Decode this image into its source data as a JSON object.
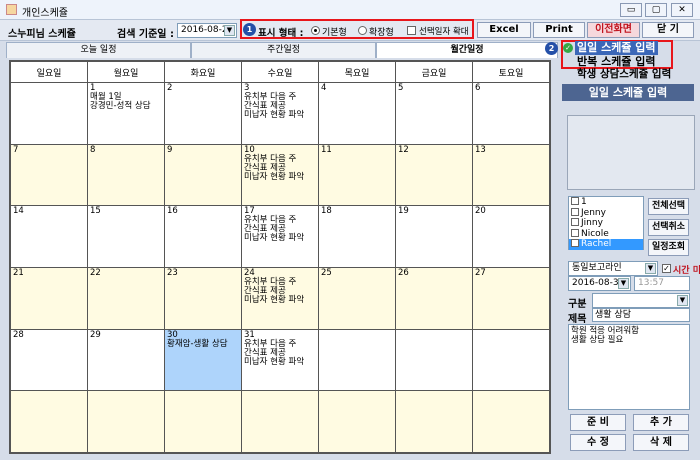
{
  "window": {
    "title": "개인스케쥴",
    "min": "▭",
    "max": "▢",
    "close": "✕"
  },
  "toolbar": {
    "scheduleName": "스누피님 스케쥴",
    "dateLabel": "검색 기준일 :",
    "dateValue": "2016-08-29",
    "marker1": "1",
    "displayLabel": "표시 형태 :",
    "radioBasic": "기본형",
    "radioExpand": "확장형",
    "checkExpand": "선택일자 확대",
    "btnExcel": "Excel",
    "btnPrint": "Print",
    "btnPrev": "이전화면",
    "btnClose": "닫 기"
  },
  "tabs": [
    "오늘 일정",
    "주간일정",
    "월간일정"
  ],
  "calendar": {
    "weekdays": [
      "일요일",
      "월요일",
      "화요일",
      "수요일",
      "목요일",
      "금요일",
      "토요일"
    ],
    "weeks": [
      [
        {
          "d": ""
        },
        {
          "d": "1",
          "t": "매월 1일\n강경민-성적 상담"
        },
        {
          "d": "2"
        },
        {
          "d": "3",
          "t": "유치부 다음 주\n간식표 제공\n미납자 현황 파악"
        },
        {
          "d": "4"
        },
        {
          "d": "5"
        },
        {
          "d": "6"
        }
      ],
      [
        {
          "d": "7"
        },
        {
          "d": "8"
        },
        {
          "d": "9"
        },
        {
          "d": "10",
          "t": "유치부 다음 주\n간식표 제공\n미납자 현황 파악"
        },
        {
          "d": "11"
        },
        {
          "d": "12"
        },
        {
          "d": "13"
        }
      ],
      [
        {
          "d": "14"
        },
        {
          "d": "15"
        },
        {
          "d": "16"
        },
        {
          "d": "17",
          "t": "유치부 다음 주\n간식표 제공\n미납자 현황 파악"
        },
        {
          "d": "18"
        },
        {
          "d": "19"
        },
        {
          "d": "20"
        }
      ],
      [
        {
          "d": "21"
        },
        {
          "d": "22"
        },
        {
          "d": "23"
        },
        {
          "d": "24",
          "t": "유치부 다음 주\n간식표 제공\n미납자 현황 파악"
        },
        {
          "d": "25"
        },
        {
          "d": "26"
        },
        {
          "d": "27"
        }
      ],
      [
        {
          "d": "28"
        },
        {
          "d": "29"
        },
        {
          "d": "30",
          "t": "황재암-생활 상담",
          "hl": true
        },
        {
          "d": "31",
          "t": "유치부 다음 주\n간식표 제공\n미납자 현황 파악"
        },
        {
          "d": ""
        },
        {
          "d": ""
        },
        {
          "d": ""
        }
      ],
      [
        {
          "d": ""
        },
        {
          "d": ""
        },
        {
          "d": ""
        },
        {
          "d": ""
        },
        {
          "d": ""
        },
        {
          "d": ""
        },
        {
          "d": ""
        }
      ]
    ]
  },
  "right": {
    "marker2": "2",
    "item1": "일일 스케쥴 입력",
    "item2": "반복 스케쥴 입력",
    "item3": "학생 상담스케쥴 입력",
    "sectionTitle": "일일 스케쥴 입력",
    "users": [
      "1",
      "Jenny",
      "Jinny",
      "Nicole",
      "Rachel"
    ],
    "btnSelectAll": "전체선택",
    "btnDeselect": "선택취소",
    "btnView": "일정조회",
    "category": "동일보고라인",
    "timeInput": "시간 미입력",
    "date2": "2016-08-30",
    "time2": "13:57",
    "labelType": "구분",
    "labelTitle": "제목",
    "titleValue": "생활 상담",
    "content": "학원 적응 어려워함\n생활 상담 필요",
    "btnPrepare": "준 비",
    "btnAdd": "추 가",
    "btnEdit": "수 정",
    "btnDelete": "삭 제"
  }
}
